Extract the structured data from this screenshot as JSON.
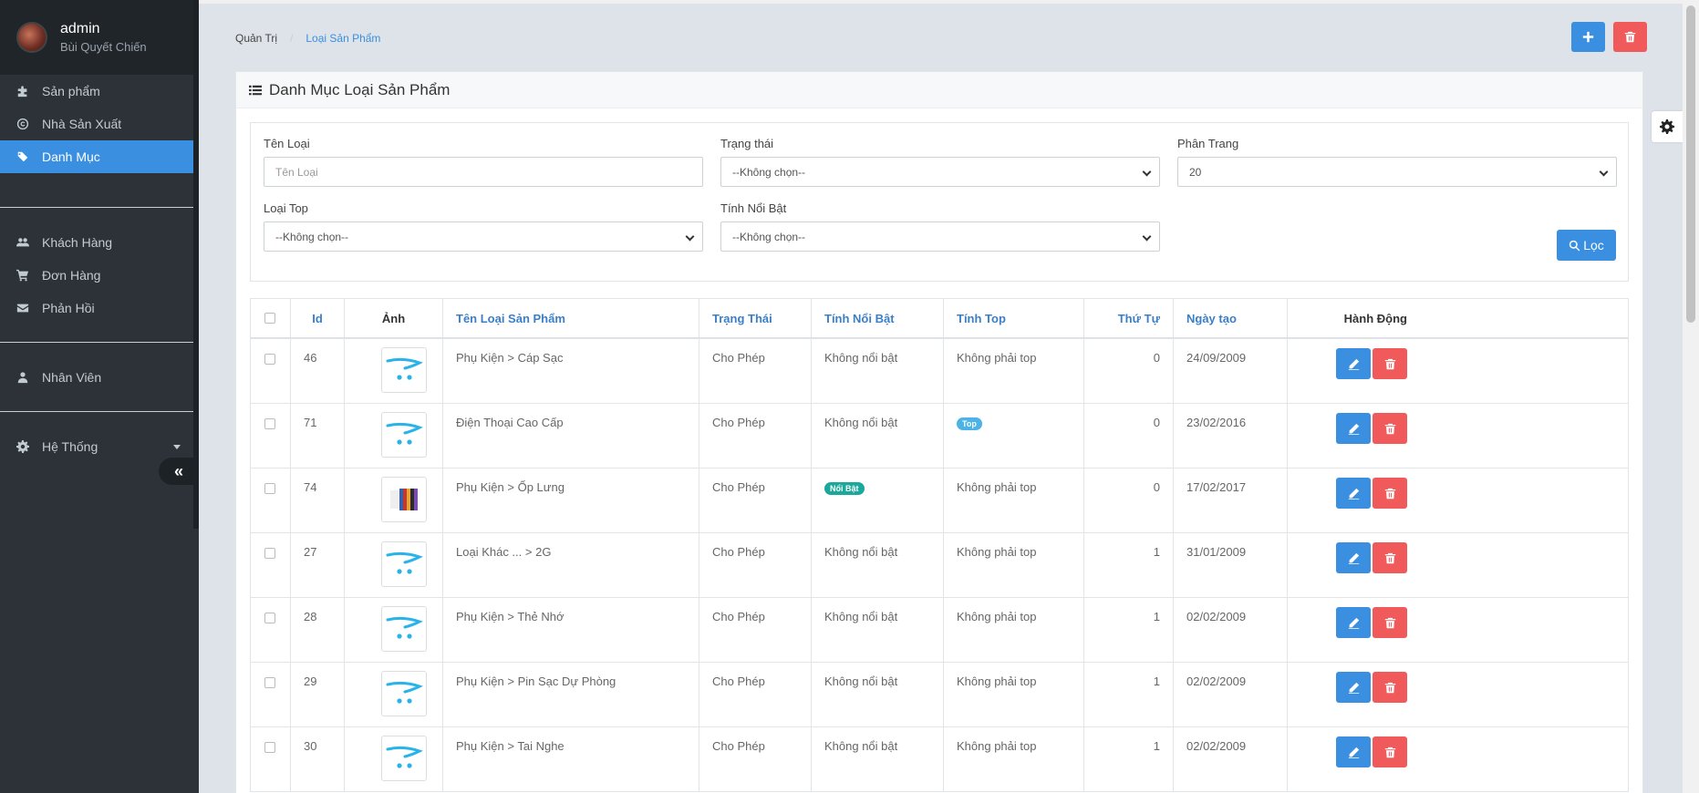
{
  "profile": {
    "name": "admin",
    "fullname": "Bùi Quyết Chiến"
  },
  "menu": {
    "products": "Sản phẩm",
    "manufacturers": "Nhà Sản Xuất",
    "categories": "Danh Mục",
    "customers": "Khách Hàng",
    "orders": "Đơn Hàng",
    "feedback": "Phản Hồi",
    "staff": "Nhân Viên",
    "system": "Hệ Thống"
  },
  "breadcrumb": {
    "home": "Quản Trị",
    "current": "Loại Sản Phẩm"
  },
  "panel": {
    "title": "Danh Mục Loại Sản Phẩm"
  },
  "filters": {
    "name_label": "Tên Loại",
    "name_placeholder": "Tên Loại",
    "status_label": "Trạng thái",
    "status_value": "--Không chọn--",
    "paging_label": "Phân Trang",
    "paging_value": "20",
    "top_label": "Loại Top",
    "top_value": "--Không chọn--",
    "featured_label": "Tính Nổi Bật",
    "featured_value": "--Không chọn--",
    "filter_button": "Lọc"
  },
  "table": {
    "headers": {
      "id": "Id",
      "image": "Ảnh",
      "name": "Tên Loại Sản Phẩm",
      "status": "Trạng Thái",
      "featured": "Tính Nổi Bật",
      "top": "Tính Top",
      "order": "Thứ Tự",
      "created": "Ngày tạo",
      "actions": "Hành Động"
    },
    "rows": [
      {
        "id": "46",
        "name": "Phụ Kiện > Cáp Sạc",
        "status": "Cho Phép",
        "featured": "Không nổi bật",
        "top": "Không phải top",
        "order": "0",
        "created": "24/09/2009"
      },
      {
        "id": "71",
        "name": "Điện Thoại Cao Cấp",
        "status": "Cho Phép",
        "featured": "Không nổi bật",
        "top_badge": "Top",
        "order": "0",
        "created": "23/02/2016"
      },
      {
        "id": "74",
        "name": "Phụ Kiện > Ốp Lưng",
        "status": "Cho Phép",
        "featured_badge": "Nổi Bật",
        "top": "Không phải top",
        "order": "0",
        "created": "17/02/2017"
      },
      {
        "id": "27",
        "name": "Loại Khác ... > 2G",
        "status": "Cho Phép",
        "featured": "Không nổi bật",
        "top": "Không phải top",
        "order": "1",
        "created": "31/01/2009"
      },
      {
        "id": "28",
        "name": "Phụ Kiện > Thẻ Nhớ",
        "status": "Cho Phép",
        "featured": "Không nổi bật",
        "top": "Không phải top",
        "order": "1",
        "created": "02/02/2009"
      },
      {
        "id": "29",
        "name": "Phụ Kiện > Pin Sạc Dự Phòng",
        "status": "Cho Phép",
        "featured": "Không nổi bật",
        "top": "Không phải top",
        "order": "1",
        "created": "02/02/2009"
      },
      {
        "id": "30",
        "name": "Phụ Kiện > Tai Nghe",
        "status": "Cho Phép",
        "featured": "Không nổi bật",
        "top": "Không phải top",
        "order": "1",
        "created": "02/02/2009"
      }
    ]
  },
  "colors": {
    "primary": "#3a8fe0",
    "danger": "#f05a5a",
    "sidebar": "#2c3238",
    "badge_top": "#4bb3e6",
    "badge_featured": "#1aa89a"
  }
}
